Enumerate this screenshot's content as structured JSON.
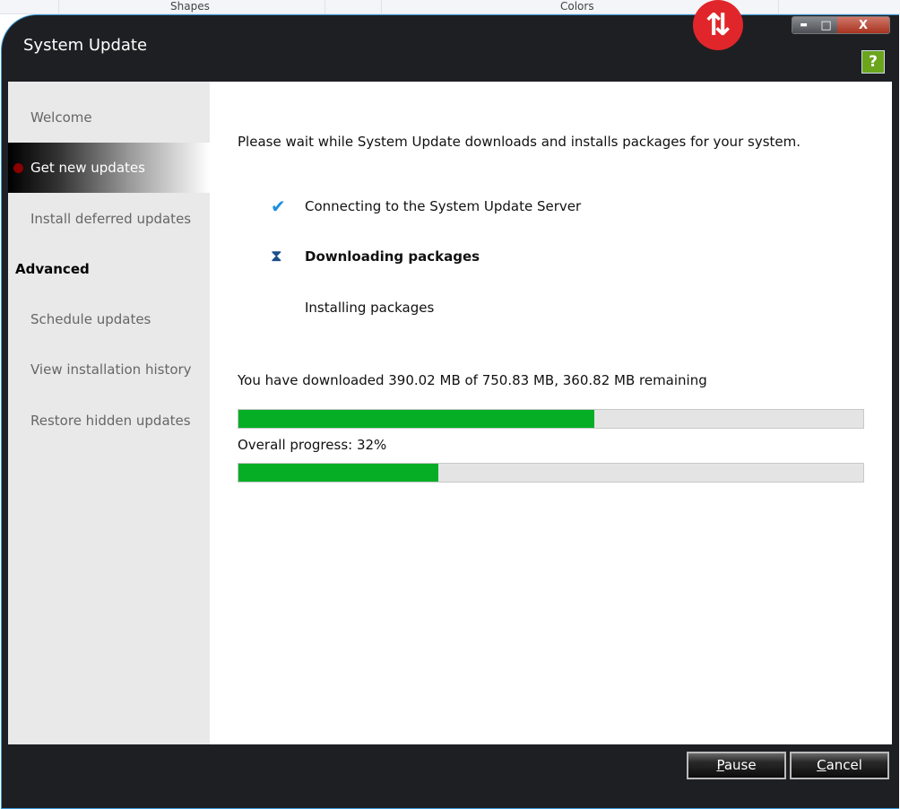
{
  "ribbon": {
    "shapes": "Shapes",
    "colors": "Colors"
  },
  "window": {
    "title": "System Update",
    "minimize": "▬",
    "maximize": "□",
    "close": "X",
    "help": "?"
  },
  "sidebar": {
    "items": [
      {
        "label": "Welcome",
        "state": "normal"
      },
      {
        "label": "Get new updates",
        "state": "active"
      },
      {
        "label": "Install deferred updates",
        "state": "normal"
      },
      {
        "label": "Advanced",
        "state": "header"
      },
      {
        "label": "Schedule updates",
        "state": "normal"
      },
      {
        "label": "View installation history",
        "state": "normal"
      },
      {
        "label": "Restore hidden updates",
        "state": "normal"
      }
    ]
  },
  "main": {
    "intro": "Please wait while System Update downloads and installs packages for your system.",
    "steps": [
      {
        "label": "Connecting to the System Update Server",
        "status": "done",
        "icon": "checkmark-icon"
      },
      {
        "label": "Downloading packages",
        "status": "in-progress",
        "icon": "hourglass-icon"
      },
      {
        "label": "Installing packages",
        "status": "pending"
      }
    ],
    "download_status": "You have downloaded  390.02 MB of  750.83 MB,  360.82 MB remaining",
    "download_progress_percent": 57,
    "overall_label": "Overall progress: 32%",
    "overall_progress_percent": 32
  },
  "buttons": {
    "pause_u": "P",
    "pause_rest": "ause",
    "cancel_u": "C",
    "cancel_rest": "ancel"
  },
  "colors": {
    "progress": "#06ae25",
    "active_dot": "#8b0000",
    "check": "#1e8fe0"
  }
}
